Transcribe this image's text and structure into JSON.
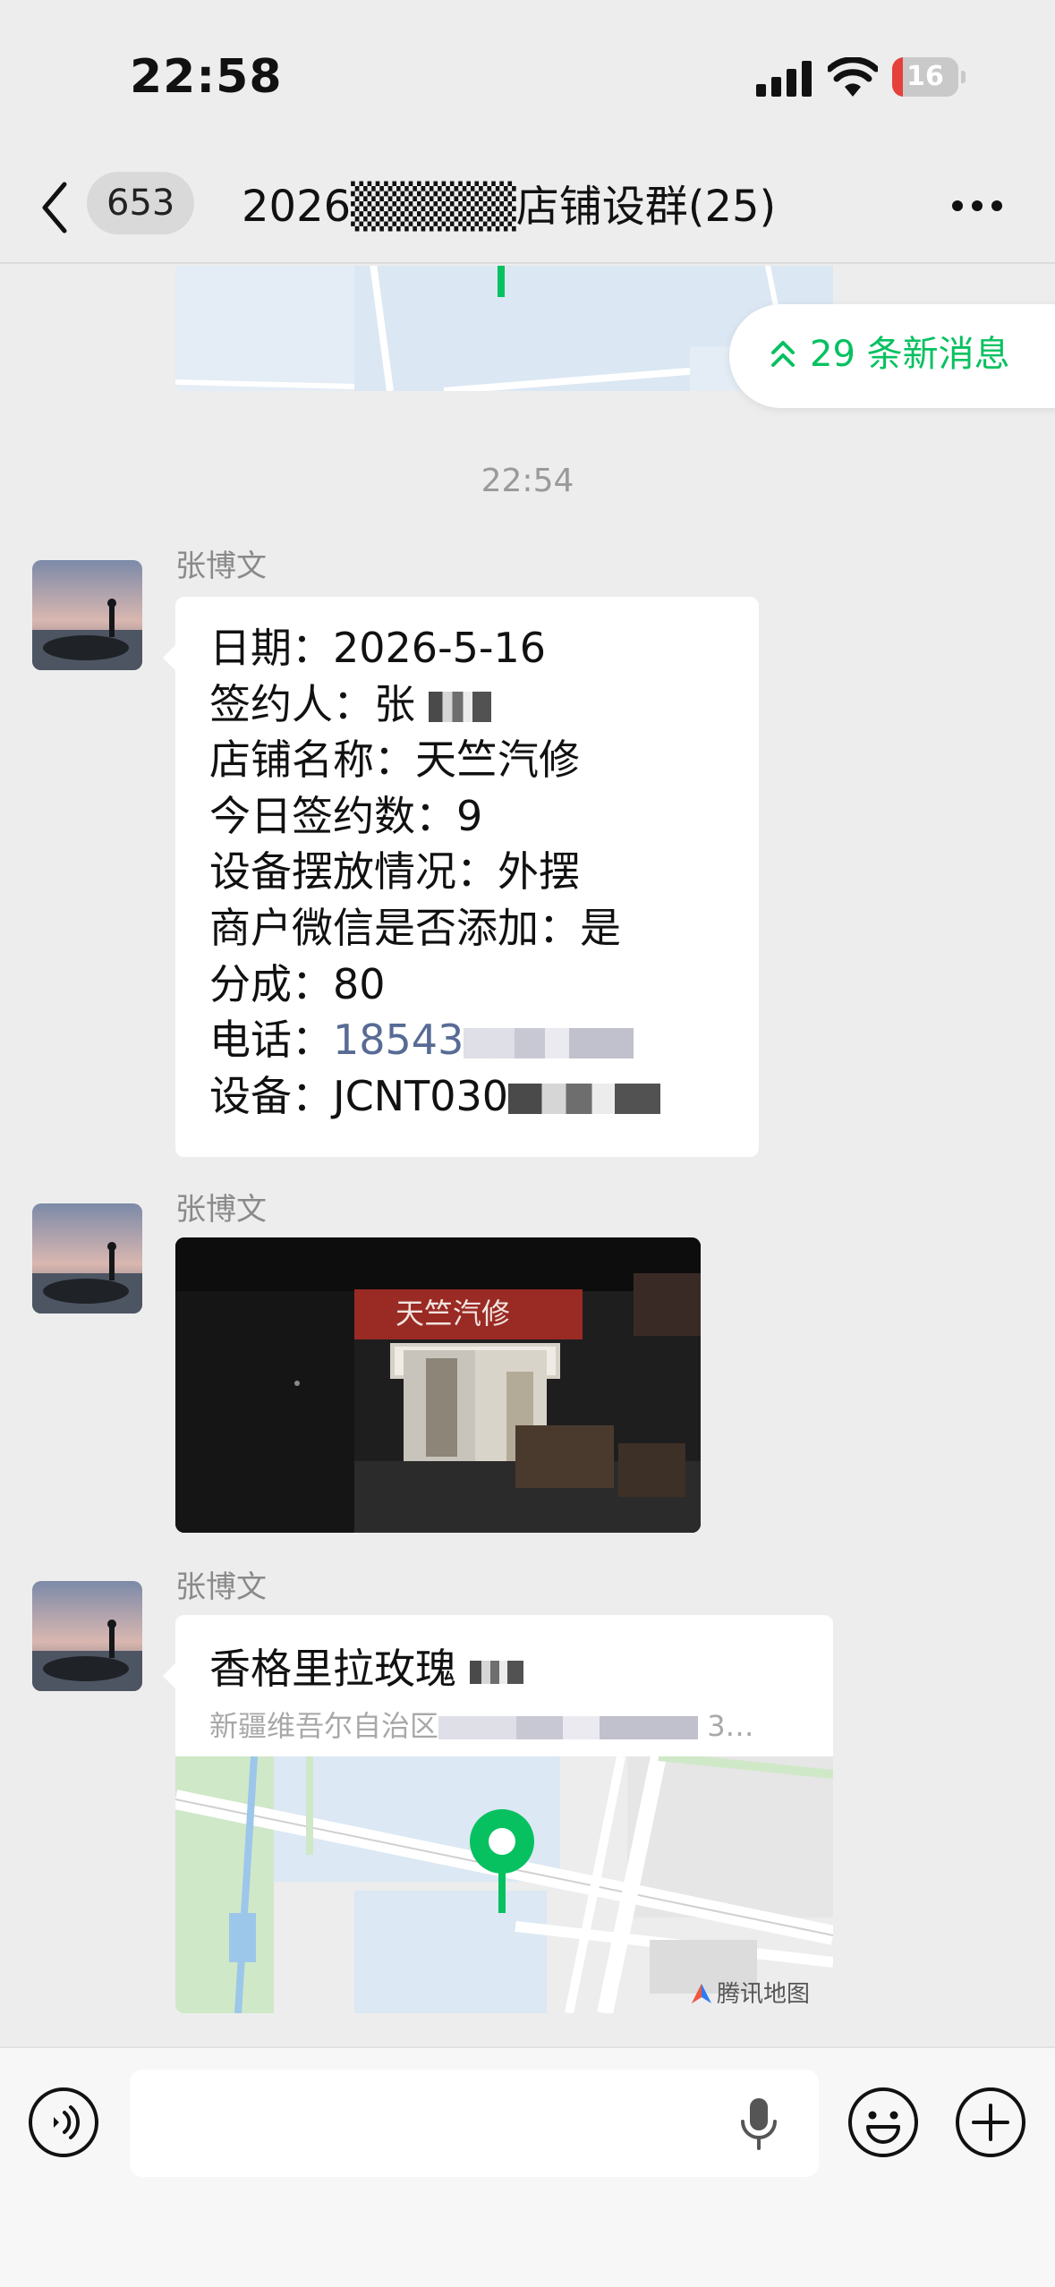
{
  "status_bar": {
    "time": "22:58",
    "battery_level": "16",
    "battery_fraction": 0.16,
    "signal_icon": "signal-bars-icon",
    "wifi_icon": "wifi-icon"
  },
  "nav": {
    "unread_count": "653",
    "title": "2026▒▒▒▒▒店铺设群(25)",
    "back_icon": "chevron-left-icon",
    "more_icon": "ellipsis-icon"
  },
  "chat": {
    "new_messages_label": "29 条新消息",
    "timestamp": "22:54",
    "messages": [
      {
        "sender": "张博文",
        "type": "text",
        "lines": [
          {
            "label": "日期：",
            "value": "2026-5-16"
          },
          {
            "label": "签约人：",
            "value": "张"
          },
          {
            "label": "店铺名称：",
            "value": "天竺汽修"
          },
          {
            "label": "今日签约数：",
            "value": "9"
          },
          {
            "label": "设备摆放情况：",
            "value": "外摆"
          },
          {
            "label": "商户微信是否添加：",
            "value": "是"
          },
          {
            "label": "分成：",
            "value": "80"
          },
          {
            "label": "电话：",
            "value": "18543"
          },
          {
            "label": "设备：",
            "value": "JCNT030"
          }
        ]
      },
      {
        "sender": "张博文",
        "type": "image",
        "sign_text": "天竺汽修"
      },
      {
        "sender": "张博文",
        "type": "location",
        "title": "香格里拉玫瑰",
        "address": "新疆维吾尔自治区",
        "address_tail": "3…",
        "map_brand": "腾讯地图"
      }
    ]
  },
  "input_bar": {
    "placeholder": "",
    "voice_icon": "voice-mode-icon",
    "mic_icon": "microphone-icon",
    "emoji_icon": "smiley-icon",
    "plus_icon": "plus-circle-icon"
  },
  "colors": {
    "accent": "#07c160",
    "link": "#576b95",
    "background": "#ededed",
    "battery_low": "#e5403b"
  }
}
